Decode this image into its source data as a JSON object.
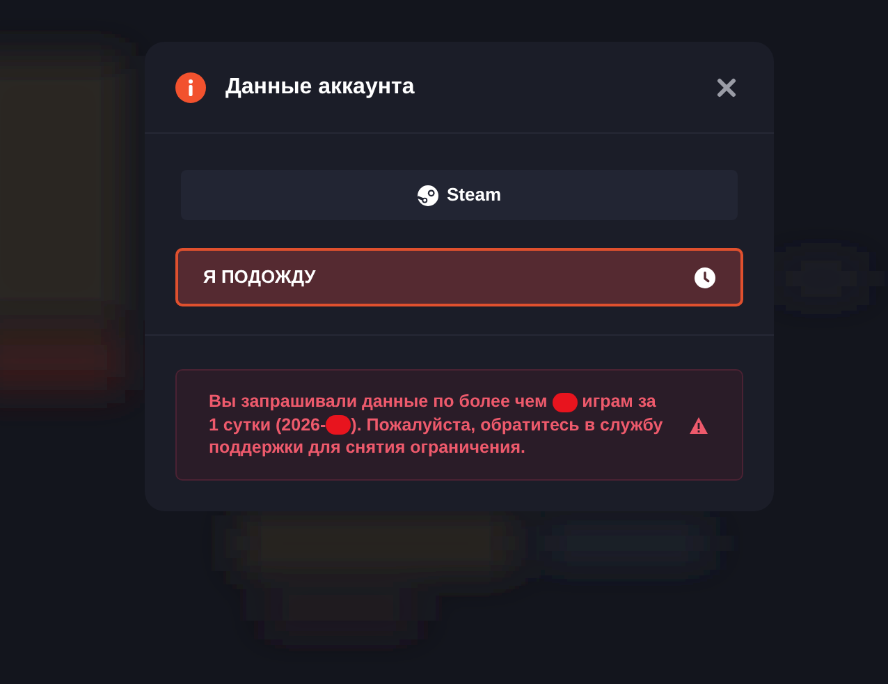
{
  "dialog": {
    "title": "Данные аккаунта"
  },
  "steam_button": {
    "label": "Steam"
  },
  "wait_button": {
    "label": "Я ПОДОЖДУ",
    "selected": true
  },
  "alert": {
    "segments": [
      {
        "kind": "text",
        "text": "Вы запрашивали данные по более чем "
      },
      {
        "kind": "redacted"
      },
      {
        "kind": "text",
        "text": " играм за 1 сутки (2026-"
      },
      {
        "kind": "redacted"
      },
      {
        "kind": "text",
        "text": "). Пожалуйста, обратитесь в службу поддержки для снятия ограничения."
      }
    ]
  }
}
